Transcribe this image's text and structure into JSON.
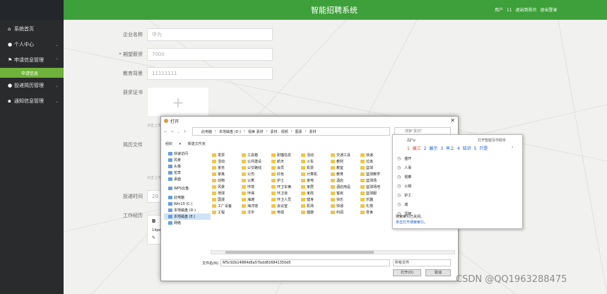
{
  "header": {
    "title": "智能招聘系统",
    "user_links": "用户 11  退出到前台  退出登录"
  },
  "sidebar": {
    "items": [
      {
        "label": "系统首页",
        "icon": "home-icon",
        "chevron": ""
      },
      {
        "label": "个人中心",
        "icon": "user-icon",
        "chevron": "⌄"
      },
      {
        "label": "申请信息管理",
        "icon": "flag-icon",
        "chevron": "⌃"
      },
      {
        "label": "投递简历管理",
        "icon": "pin-icon",
        "chevron": "⌄"
      },
      {
        "label": "通知信息管理",
        "icon": "message-icon",
        "chevron": "⌄"
      }
    ],
    "sub_item": "申请信息"
  },
  "form": {
    "company_label": "企业名称",
    "company_value": "华为",
    "salary_label": "* 期望薪资",
    "salary_value": "7000",
    "education_label": "教育背景",
    "education_value": "11111111",
    "cert_label": "获奖证书",
    "upload_plus": "+",
    "resume_label": "简历文件",
    "time_label": "投递时间",
    "time_value": "20",
    "exp_label": "工作经历",
    "note1": "点击上传",
    "note2": "点击上传",
    "editor_b": "B",
    "editor_size": "14px"
  },
  "dialog": {
    "title": "打开",
    "close": "✕",
    "breadcrumbs": [
      "此电脑",
      "本地磁盘 (D:)",
      "视美 素材",
      "素材、视频",
      "图素",
      "素材"
    ],
    "search_placeholder": "搜索\"素材\"",
    "toolbar": "组织 ▾  新建文件夹",
    "nav": [
      {
        "label": "快速访问",
        "selected": false
      },
      {
        "label": "风景",
        "selected": false
      },
      {
        "label": "头像",
        "selected": false
      },
      {
        "label": "花草",
        "selected": false
      },
      {
        "label": "桌面",
        "selected": false
      },
      {
        "label": "WPS云盘",
        "selected": false
      },
      {
        "label": "此电脑",
        "selected": false
      },
      {
        "label": "Win10 (C:)",
        "selected": false
      },
      {
        "label": "本地磁盘 (D:)",
        "selected": false
      },
      {
        "label": "本地磁盘 (E:)",
        "selected": true
      },
      {
        "label": "网络",
        "selected": false
      }
    ],
    "file_columns": [
      [
        "发票",
        "活动",
        "家务",
        "家禽",
        "动物",
        "风景",
        "地球",
        "国漫",
        "工厂设备",
        "工程"
      ],
      [
        "工具箱",
        "公共建设",
        "公交路线",
        "公司",
        "公寓",
        "环境",
        "环保",
        "海滩",
        "海洋馆",
        "汉字"
      ],
      [
        "耐猫信息",
        "航天",
        "会员",
        "红色",
        "护士",
        "环卫车辆",
        "环卫道",
        "环卫人员",
        "会议室",
        "电视"
      ],
      [
        "活动",
        "火车",
        "机票",
        "计算机",
        "家电",
        "家居",
        "家政",
        "健身",
        "机场",
        "健康"
      ],
      [
        "交通工具",
        "教材",
        "教室",
        "教育",
        "酒店",
        "酒店用品",
        "客房",
        "快乐",
        "快递",
        "利润"
      ],
      [
        "快递",
        "垃圾",
        "篮球",
        "篮球教学",
        "篮球场",
        "篮球场地",
        "篮球服",
        "乐器",
        "礼物",
        "零食"
      ]
    ],
    "filename_label": "文件名(N):",
    "filename_value": "6f5c92b14884d6a57bdd816841350d5",
    "filetype_value": "所有文件",
    "open_button": "打开(O)",
    "cancel_button": "取消"
  },
  "ime": {
    "pinyin": "zz'u",
    "translate_hint": "打开智能写作助手",
    "candidates": [
      "1 展三",
      "2 展示",
      "3 早上",
      "4 知识",
      "5 只是"
    ],
    "more": "›",
    "history": [
      "盛开",
      "人事",
      "观察",
      "火锅",
      "护工",
      "城",
      "坚韧"
    ],
    "footer1": "搜索索引已关闭。",
    "footer2": "单击打开搜索索引。"
  },
  "watermark": "CSDN @QQ1963288475",
  "colors": {
    "header_green": "#3ea03a",
    "sidebar_bg": "#2a2b2d",
    "sub_green": "#6fb13b"
  }
}
